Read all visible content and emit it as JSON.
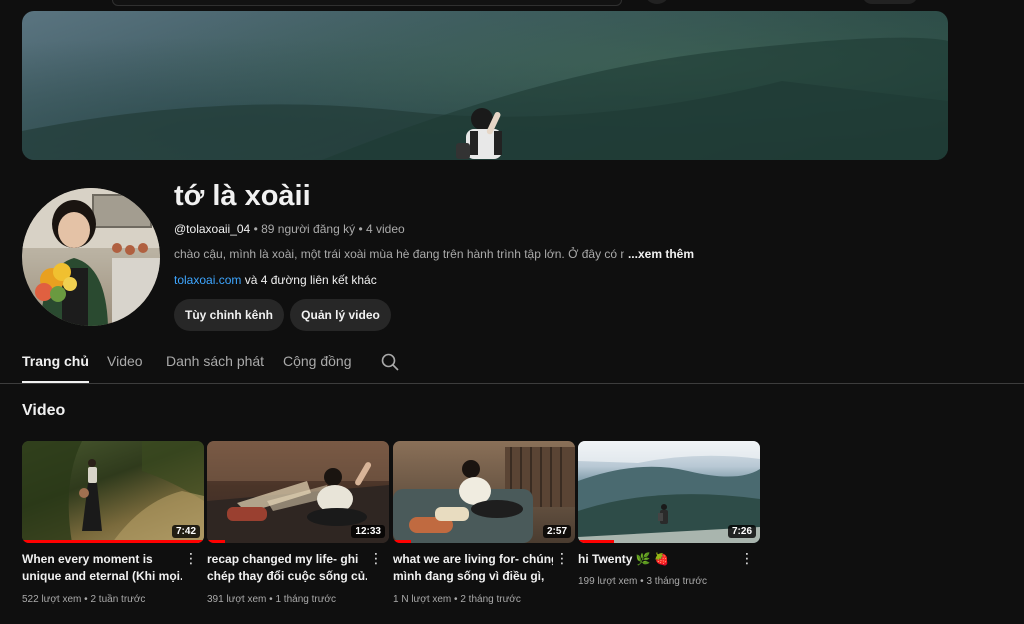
{
  "channel": {
    "name": "tớ là xoàii",
    "handle": "@tolaxoaii_04",
    "subscribers": "89 người đăng ký",
    "video_count": "4 video",
    "description": "chào cậu, mình là xoài, một trái xoài mùa hè đang trên hành trình tập lớn. Ở đây có nhiều",
    "more_label": "...xem thêm",
    "link": "tolaxoai.com",
    "link_more": "và 4 đường liên kết khác"
  },
  "actions": {
    "customize": "Tùy chỉnh kênh",
    "manage": "Quản lý video"
  },
  "tabs": [
    "Trang chủ",
    "Video",
    "Danh sách phát",
    "Cộng đồng"
  ],
  "section": {
    "title": "Video"
  },
  "videos": [
    {
      "title_lines": [
        "When every moment is",
        "unique and eternal (Khi mọi..."
      ],
      "views": "522 lượt xem",
      "age": "2 tuần trước",
      "duration": "7:42",
      "watched": 1.0
    },
    {
      "title_lines": [
        "recap changed my life- ghi",
        "chép thay đổi cuộc sống củ..."
      ],
      "views": "391 lượt xem",
      "age": "1 tháng trước",
      "duration": "12:33",
      "watched": 0.1
    },
    {
      "title_lines": [
        "what we are living for- chúng",
        "mình đang sống vì điều gì,"
      ],
      "views": "1 N lượt xem",
      "age": "2 tháng trước",
      "duration": "2:57",
      "watched": 0.1
    },
    {
      "title_lines": [
        "hi Twenty 🌿 🍓"
      ],
      "views": "199 lượt xem",
      "age": "3 tháng trước",
      "duration": "7:26",
      "watched": 0.2
    }
  ]
}
